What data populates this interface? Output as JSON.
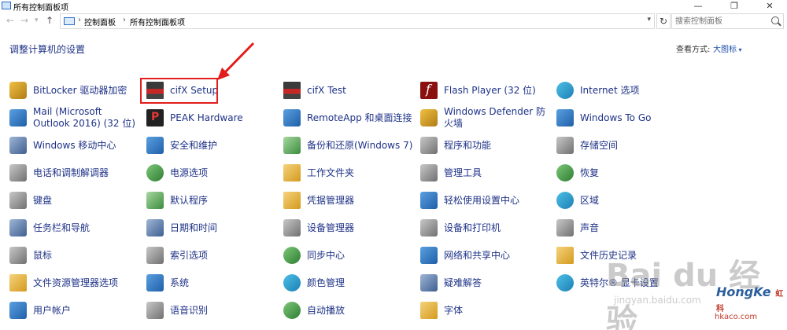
{
  "window": {
    "title": "所有控制面板项",
    "controls": [
      "—",
      "❐",
      "✕"
    ]
  },
  "address": {
    "crumbs": [
      "控制面板",
      "所有控制面板项"
    ],
    "search_placeholder": "搜索控制面板"
  },
  "header": {
    "heading": "调整计算机的设置",
    "view_by_label": "查看方式:",
    "view_by_value": "大图标"
  },
  "items": {
    "col1": [
      "BitLocker 驱动器加密",
      "Mail (Microsoft Outlook 2016) (32 位)",
      "Windows 移动中心",
      "电话和调制解调器",
      "键盘",
      "任务栏和导航",
      "鼠标",
      "文件资源管理器选项",
      "用户帐户"
    ],
    "col2": [
      "cifX Setup",
      "PEAK Hardware",
      "安全和维护",
      "电源选项",
      "默认程序",
      "日期和时间",
      "索引选项",
      "系统",
      "语音识别"
    ],
    "col3": [
      "cifX Test",
      "RemoteApp 和桌面连接",
      "备份和还原(Windows 7)",
      "工作文件夹",
      "凭据管理器",
      "设备管理器",
      "同步中心",
      "颜色管理",
      "自动播放"
    ],
    "col4": [
      "Flash Player (32 位)",
      "Windows Defender 防火墙",
      "程序和功能",
      "管理工具",
      "轻松使用设置中心",
      "设备和打印机",
      "网络和共享中心",
      "疑难解答",
      "字体"
    ],
    "col5": [
      "Internet 选项",
      "Windows To Go",
      "存储空间",
      "恢复",
      "区域",
      "声音",
      "文件历史记录",
      "英特尔® 显卡设置",
      ""
    ]
  },
  "watermark": {
    "baidu": "Bai du 经验",
    "jingyan": "jingyan.baidu.com",
    "hongke": "HongKe",
    "hongke_sub": "虹科",
    "hkaco": "hkaco.com"
  },
  "colors": {
    "link": "#1e3287",
    "highlight": "#e21d1d"
  }
}
